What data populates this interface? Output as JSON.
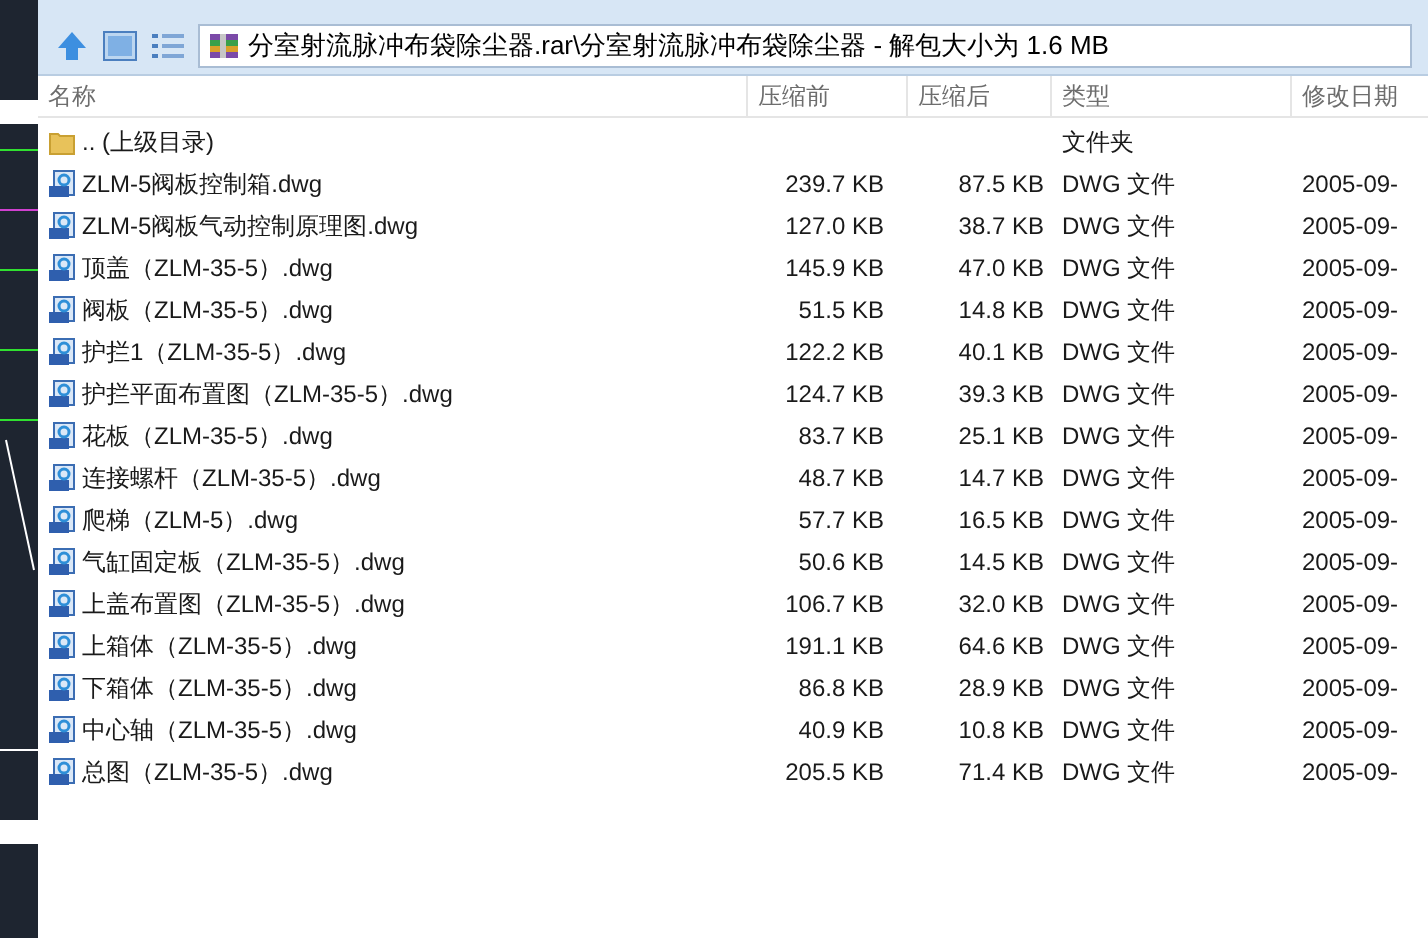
{
  "address": {
    "path": "分室射流脉冲布袋除尘器.rar\\分室射流脉冲布袋除尘器 - 解包大小为 1.6 MB"
  },
  "table": {
    "columns": [
      "名称",
      "压缩前",
      "压缩后",
      "类型",
      "修改日期"
    ],
    "rows": [
      {
        "kind": "folder",
        "name": ".. (上级目录)",
        "size": "",
        "packed": "",
        "type": "文件夹",
        "modified": ""
      },
      {
        "kind": "dwg",
        "name": "ZLM-5阀板控制箱.dwg",
        "size": "239.7 KB",
        "packed": "87.5 KB",
        "type": "DWG 文件",
        "modified": "2005-09-"
      },
      {
        "kind": "dwg",
        "name": "ZLM-5阀板气动控制原理图.dwg",
        "size": "127.0 KB",
        "packed": "38.7 KB",
        "type": "DWG 文件",
        "modified": "2005-09-"
      },
      {
        "kind": "dwg",
        "name": "顶盖（ZLM-35-5）.dwg",
        "size": "145.9 KB",
        "packed": "47.0 KB",
        "type": "DWG 文件",
        "modified": "2005-09-"
      },
      {
        "kind": "dwg",
        "name": "阀板（ZLM-35-5）.dwg",
        "size": "51.5 KB",
        "packed": "14.8 KB",
        "type": "DWG 文件",
        "modified": "2005-09-"
      },
      {
        "kind": "dwg",
        "name": "护拦1（ZLM-35-5）.dwg",
        "size": "122.2 KB",
        "packed": "40.1 KB",
        "type": "DWG 文件",
        "modified": "2005-09-"
      },
      {
        "kind": "dwg",
        "name": "护拦平面布置图（ZLM-35-5）.dwg",
        "size": "124.7 KB",
        "packed": "39.3 KB",
        "type": "DWG 文件",
        "modified": "2005-09-"
      },
      {
        "kind": "dwg",
        "name": "花板（ZLM-35-5）.dwg",
        "size": "83.7 KB",
        "packed": "25.1 KB",
        "type": "DWG 文件",
        "modified": "2005-09-"
      },
      {
        "kind": "dwg",
        "name": "连接螺杆（ZLM-35-5）.dwg",
        "size": "48.7 KB",
        "packed": "14.7 KB",
        "type": "DWG 文件",
        "modified": "2005-09-"
      },
      {
        "kind": "dwg",
        "name": "爬梯（ZLM-5）.dwg",
        "size": "57.7 KB",
        "packed": "16.5 KB",
        "type": "DWG 文件",
        "modified": "2005-09-"
      },
      {
        "kind": "dwg",
        "name": "气缸固定板（ZLM-35-5）.dwg",
        "size": "50.6 KB",
        "packed": "14.5 KB",
        "type": "DWG 文件",
        "modified": "2005-09-"
      },
      {
        "kind": "dwg",
        "name": "上盖布置图（ZLM-35-5）.dwg",
        "size": "106.7 KB",
        "packed": "32.0 KB",
        "type": "DWG 文件",
        "modified": "2005-09-"
      },
      {
        "kind": "dwg",
        "name": "上箱体（ZLM-35-5）.dwg",
        "size": "191.1 KB",
        "packed": "64.6 KB",
        "type": "DWG 文件",
        "modified": "2005-09-"
      },
      {
        "kind": "dwg",
        "name": "下箱体（ZLM-35-5）.dwg",
        "size": "86.8 KB",
        "packed": "28.9 KB",
        "type": "DWG 文件",
        "modified": "2005-09-"
      },
      {
        "kind": "dwg",
        "name": "中心轴（ZLM-35-5）.dwg",
        "size": "40.9 KB",
        "packed": "10.8 KB",
        "type": "DWG 文件",
        "modified": "2005-09-"
      },
      {
        "kind": "dwg",
        "name": "总图（ZLM-35-5）.dwg",
        "size": "205.5 KB",
        "packed": "71.4 KB",
        "type": "DWG 文件",
        "modified": "2005-09-"
      }
    ]
  }
}
